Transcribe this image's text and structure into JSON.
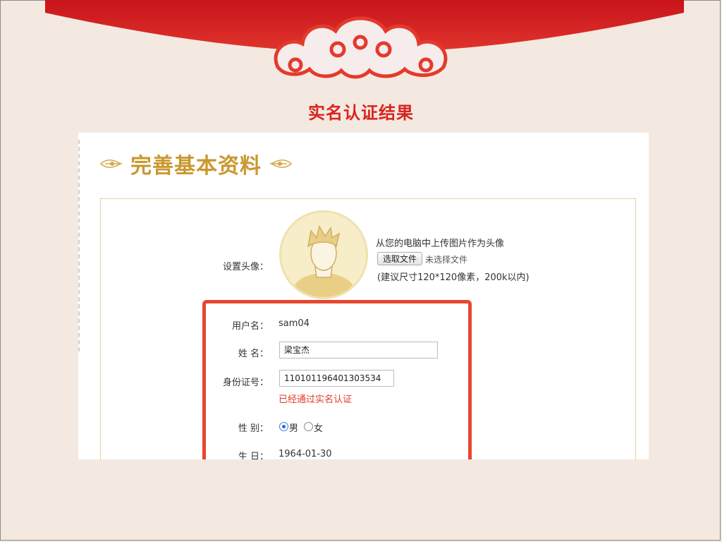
{
  "slide": {
    "title": "实名认证结果"
  },
  "section": {
    "title": "完善基本资料"
  },
  "avatar": {
    "label": "设置头像：",
    "upload_hint": "从您的电脑中上传图片作为头像",
    "choose_button": "选取文件",
    "file_status": "未选择文件",
    "size_hint": "(建议尺寸120*120像素，200k以内)"
  },
  "form": {
    "username": {
      "label": "用户名：",
      "value": "sam04"
    },
    "name": {
      "label": "姓 名：",
      "value": "梁宝杰"
    },
    "id_number": {
      "label": "身份证号：",
      "value": "110101196401303534",
      "status": "已经通过实名认证"
    },
    "gender": {
      "label": "性 别：",
      "options": [
        "男",
        "女"
      ],
      "selected": "男"
    },
    "birthday": {
      "label": "生 日：",
      "value": "1964-01-30"
    }
  },
  "colors": {
    "accent_red": "#d9231f",
    "gold": "#c9982f",
    "highlight": "#e5472f"
  }
}
